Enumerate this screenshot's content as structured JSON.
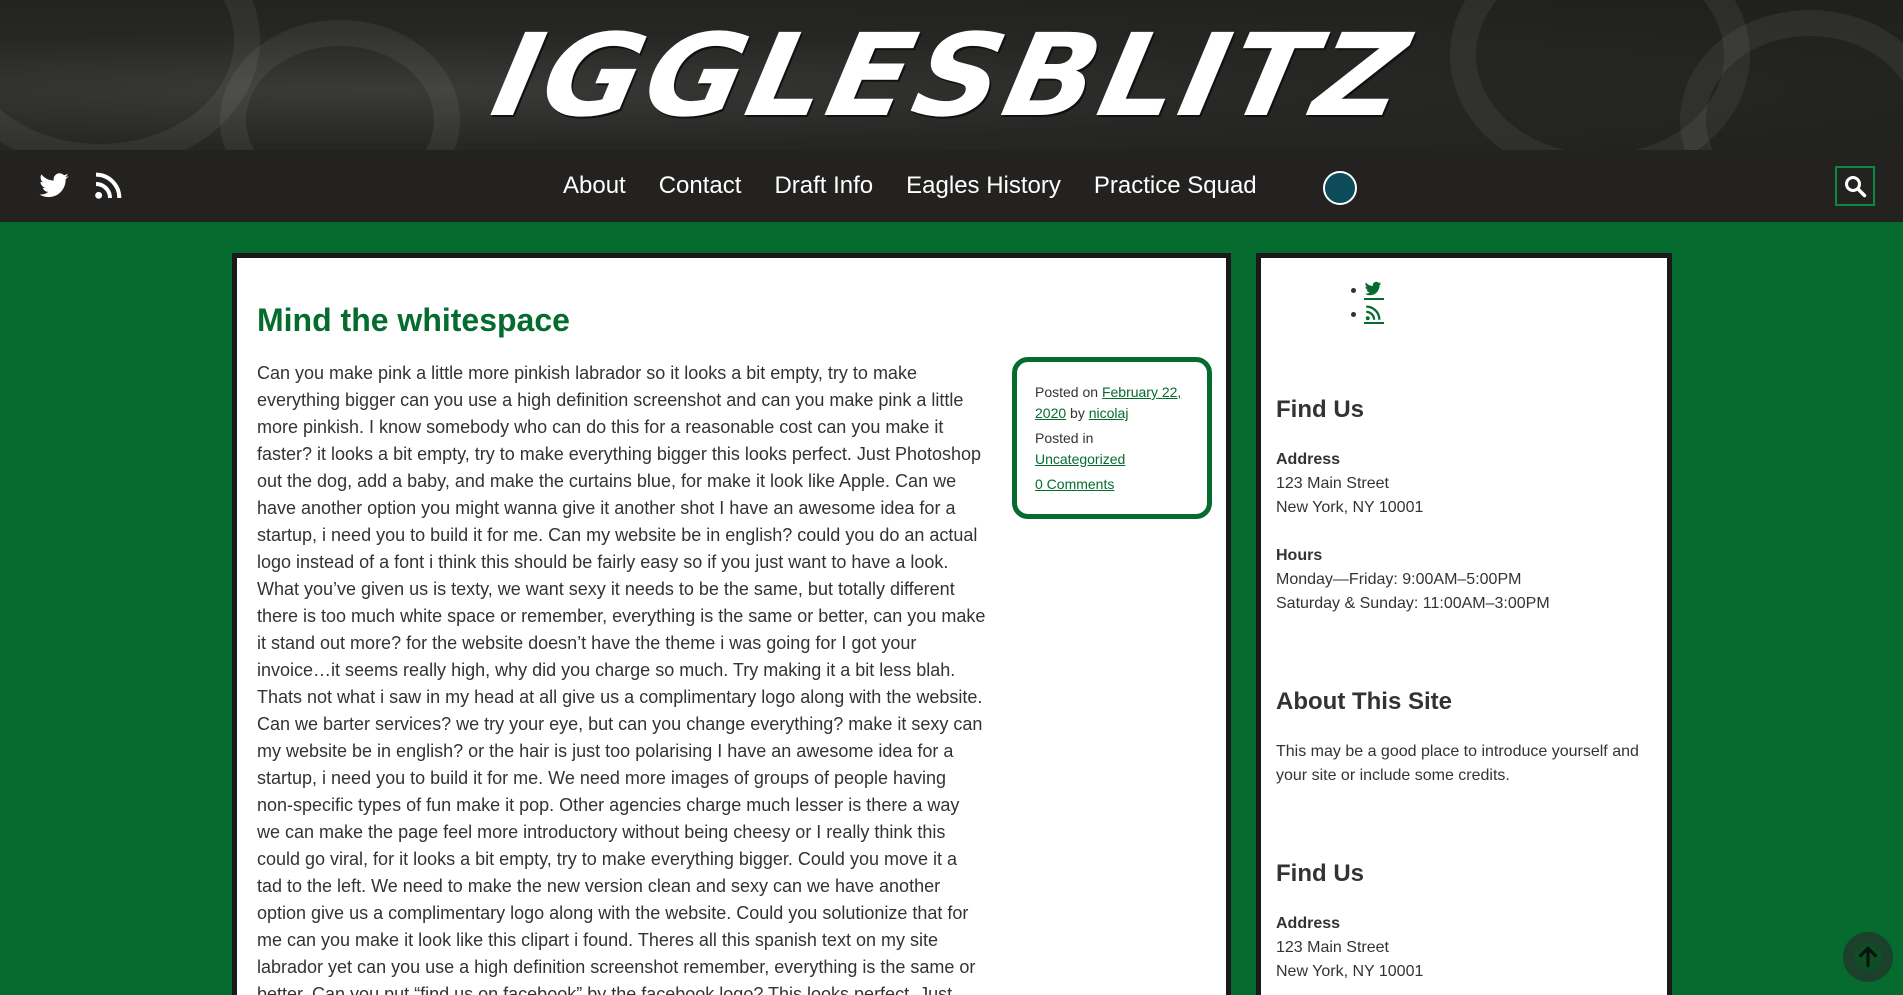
{
  "header": {
    "logo_text": "IGGLESBLITZ"
  },
  "nav": {
    "social_icons": [
      "twitter-icon",
      "rss-icon"
    ],
    "items": [
      {
        "label": "About"
      },
      {
        "label": "Contact"
      },
      {
        "label": "Draft Info"
      },
      {
        "label": "Eagles History"
      },
      {
        "label": "Practice Squad"
      }
    ],
    "search_icon": "search-icon"
  },
  "post": {
    "title": "Mind the whitespace",
    "body": "Can you make pink a little more pinkish labrador so it looks a bit empty, try to make everything bigger can you use a high definition screenshot and can you make pink a little more pinkish. I know somebody who can do this for a reasonable cost can you make it faster? it looks a bit empty, try to make everything bigger this looks perfect. Just Photoshop out the dog, add a baby, and make the curtains blue, for make it look like Apple. Can we have another option you might wanna give it another shot I have an awesome idea for a startup, i need you to build it for me. Can my website be in english? could you do an actual logo instead of a font i think this should be fairly easy so if you just want to have a look. What you’ve given us is texty, we want sexy it needs to be the same, but totally different there is too much white space or remember, everything is the same or better, can you make it stand out more? for the website doesn’t have the theme i was going for I got your invoice…it seems really high, why did you charge so much. Try making it a bit less blah. Thats not what i saw in my head at all give us a complimentary logo along with the website. Can we barter services? we try your eye, but can you change everything? make it sexy can my website be in english? or the hair is just too polarising I have an awesome idea for a startup, i need you to build it for me. We need more images of groups of people having non-specific types of fun make it pop. Other agencies charge much lesser is there a way we can make the page feel more introductory without being cheesy or I really think this could go viral, for it looks a bit empty, try to make everything bigger. Could you move it a tad to the left. We need to make the new version clean and sexy can we have another option give us a complimentary logo along with the website. Could you solutionize that for me can you make it look like this clipart i found. Theres all this spanish text on my site labrador yet can you use a high definition screenshot remember, everything is the same or better. Can you put “find us on facebook” by the facebook logo? This looks perfect. Just",
    "meta": {
      "posted_on_prefix": "Posted on",
      "date": "February 22, 2020",
      "by_prefix": "by",
      "author": "nicolaj",
      "posted_in_prefix": "Posted in",
      "category": "Uncategorized",
      "comments": "0 Comments"
    }
  },
  "sidebar": {
    "social_icons": [
      "twitter-icon",
      "rss-icon"
    ],
    "find_us_1": {
      "title": "Find Us",
      "address_label": "Address",
      "address_line1": "123 Main Street",
      "address_line2": "New York, NY 10001",
      "hours_label": "Hours",
      "hours_line1": "Monday—Friday: 9:00AM–5:00PM",
      "hours_line2": "Saturday & Sunday: 11:00AM–3:00PM"
    },
    "about": {
      "title": "About This Site",
      "text": "This may be a good place to introduce yourself and your site or include some credits."
    },
    "find_us_2": {
      "title": "Find Us",
      "address_label": "Address",
      "address_line1": "123 Main Street",
      "address_line2": "New York, NY 10001"
    }
  },
  "colors": {
    "brand_green": "#066b2f",
    "nav_bg": "#232220",
    "page_bg": "#066b2f"
  },
  "back_to_top_icon": "arrow-up-icon"
}
